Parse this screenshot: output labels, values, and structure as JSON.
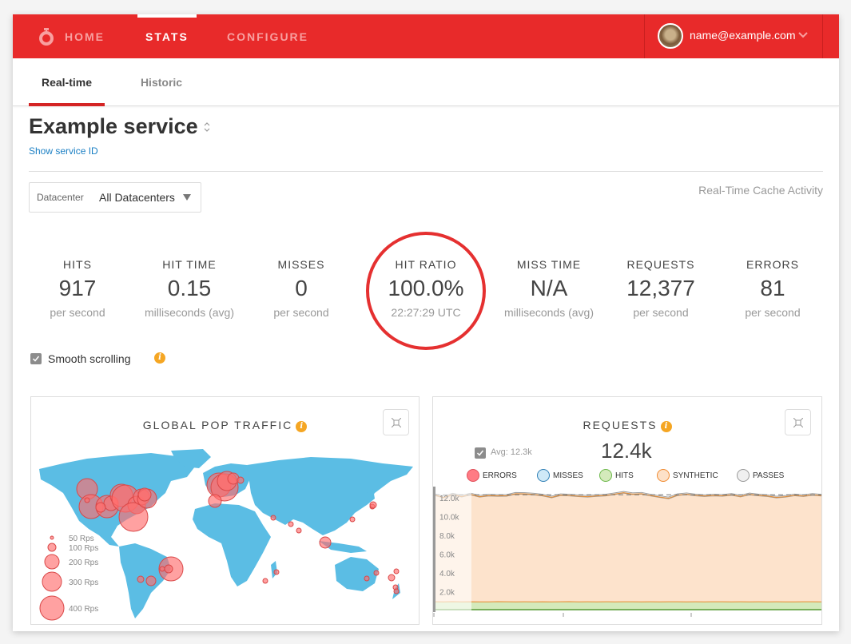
{
  "nav": {
    "logo_icon": "stopwatch-icon",
    "items": [
      {
        "label": "HOME",
        "active": false
      },
      {
        "label": "STATS",
        "active": true
      },
      {
        "label": "CONFIGURE",
        "active": false
      }
    ],
    "user": {
      "email": "name@example.com",
      "avatar_icon": "user-avatar",
      "caret_icon": "chevron-down-icon"
    }
  },
  "subtabs": [
    {
      "label": "Real-time",
      "active": true
    },
    {
      "label": "Historic",
      "active": false
    }
  ],
  "service": {
    "title": "Example service",
    "show_id_link": "Show service ID"
  },
  "datacenter": {
    "label": "Datacenter",
    "value": "All Datacenters"
  },
  "cache_activity_title": "Real-Time Cache Activity",
  "stats": [
    {
      "label": "HITS",
      "value": "917",
      "unit": "per second"
    },
    {
      "label": "HIT TIME",
      "value": "0.15",
      "unit": "milliseconds (avg)"
    },
    {
      "label": "MISSES",
      "value": "0",
      "unit": "per second"
    },
    {
      "label": "HIT RATIO",
      "value": "100.0%",
      "unit": "22:27:29 UTC"
    },
    {
      "label": "MISS TIME",
      "value": "N/A",
      "unit": "milliseconds (avg)"
    },
    {
      "label": "REQUESTS",
      "value": "12,377",
      "unit": "per second"
    },
    {
      "label": "ERRORS",
      "value": "81",
      "unit": "per second"
    }
  ],
  "smooth_scrolling": {
    "label": "Smooth scrolling",
    "checked": true
  },
  "colors": {
    "brand_red": "#e82a2a",
    "map_land": "#5bbde4",
    "bubble_fill": "#ff7b7b",
    "info_orange": "#f5a623",
    "synthetic_fill": "#fce3cc",
    "hits_fill": "#d4e9bc"
  },
  "map_panel": {
    "title": "GLOBAL POP TRAFFIC",
    "legend": [
      "50 Rps",
      "100 Rps",
      "200 Rps",
      "300 Rps",
      "400 Rps"
    ]
  },
  "requests_panel": {
    "title": "REQUESTS",
    "current": "12.4k",
    "avg_label": "Avg: 12.3k",
    "avg_checked": true,
    "series_legend": [
      {
        "label": "ERRORS",
        "fill": "#ff7b84",
        "stroke": "#e0505a"
      },
      {
        "label": "MISSES",
        "fill": "#cfe9f7",
        "stroke": "#2f7fb5"
      },
      {
        "label": "HITS",
        "fill": "#d4eabb",
        "stroke": "#6cb84a"
      },
      {
        "label": "SYNTHETIC",
        "fill": "#fde1c8",
        "stroke": "#f08a30"
      },
      {
        "label": "PASSES",
        "fill": "#f0f0f0",
        "stroke": "#999999"
      }
    ]
  },
  "chart_data": {
    "type": "area",
    "title": "REQUESTS",
    "ylabel": "",
    "xlabel": "",
    "ylim": [
      0,
      13000
    ],
    "yticks": [
      "2.0k",
      "4.0k",
      "6.0k",
      "8.0k",
      "10.0k",
      "12.0k"
    ],
    "average": 12300,
    "series": [
      {
        "name": "HITS",
        "values": [
          920,
          915,
          930,
          910,
          925,
          918,
          912,
          930,
          920,
          915,
          922,
          918,
          925,
          910,
          920,
          930,
          915,
          920,
          918,
          925,
          912,
          920,
          928,
          915,
          920,
          918,
          925,
          920,
          915,
          922,
          918,
          920,
          925,
          915,
          920,
          918,
          922,
          917,
          920,
          915,
          918,
          925,
          920,
          917
        ]
      },
      {
        "name": "SYNTHETIC",
        "values": [
          11350,
          11100,
          11400,
          11200,
          11420,
          11180,
          11300,
          11250,
          11280,
          11500,
          11480,
          11420,
          11300,
          11120,
          11350,
          11300,
          11240,
          11180,
          11260,
          11300,
          11460,
          11600,
          11450,
          11500,
          11300,
          11150,
          11000,
          11350,
          11450,
          11320,
          11250,
          11310,
          11270,
          11380,
          11200,
          11430,
          11320,
          11250,
          11100,
          11180,
          11330,
          11240,
          11380,
          11300
        ]
      },
      {
        "name": "ERRORS",
        "values": [
          81,
          80,
          82,
          79,
          81,
          83,
          80,
          81,
          82,
          80,
          81,
          79,
          81,
          82,
          80,
          81,
          80,
          82,
          81,
          80,
          81,
          79,
          82,
          80,
          81,
          80,
          81,
          82,
          80,
          81,
          80,
          81,
          82,
          80,
          81,
          79,
          81,
          80,
          82,
          81,
          80,
          81,
          80,
          81
        ]
      },
      {
        "name": "PASSES",
        "values": [
          40,
          40,
          40,
          40,
          40,
          40,
          40,
          40,
          40,
          40,
          40,
          40,
          40,
          40,
          40,
          40,
          40,
          40,
          40,
          40,
          40,
          40,
          40,
          40,
          40,
          40,
          40,
          40,
          40,
          40,
          40,
          40,
          40,
          40,
          40,
          40,
          40,
          40,
          40,
          40,
          40,
          40,
          40,
          40
        ]
      },
      {
        "name": "MISSES",
        "values": [
          0,
          0,
          0,
          0,
          0,
          0,
          0,
          0,
          0,
          0,
          0,
          0,
          0,
          0,
          0,
          0,
          0,
          0,
          0,
          0,
          0,
          0,
          0,
          0,
          0,
          0,
          0,
          0,
          0,
          0,
          0,
          0,
          0,
          0,
          0,
          0,
          0,
          0,
          0,
          0,
          0,
          0,
          0,
          0
        ]
      }
    ]
  }
}
